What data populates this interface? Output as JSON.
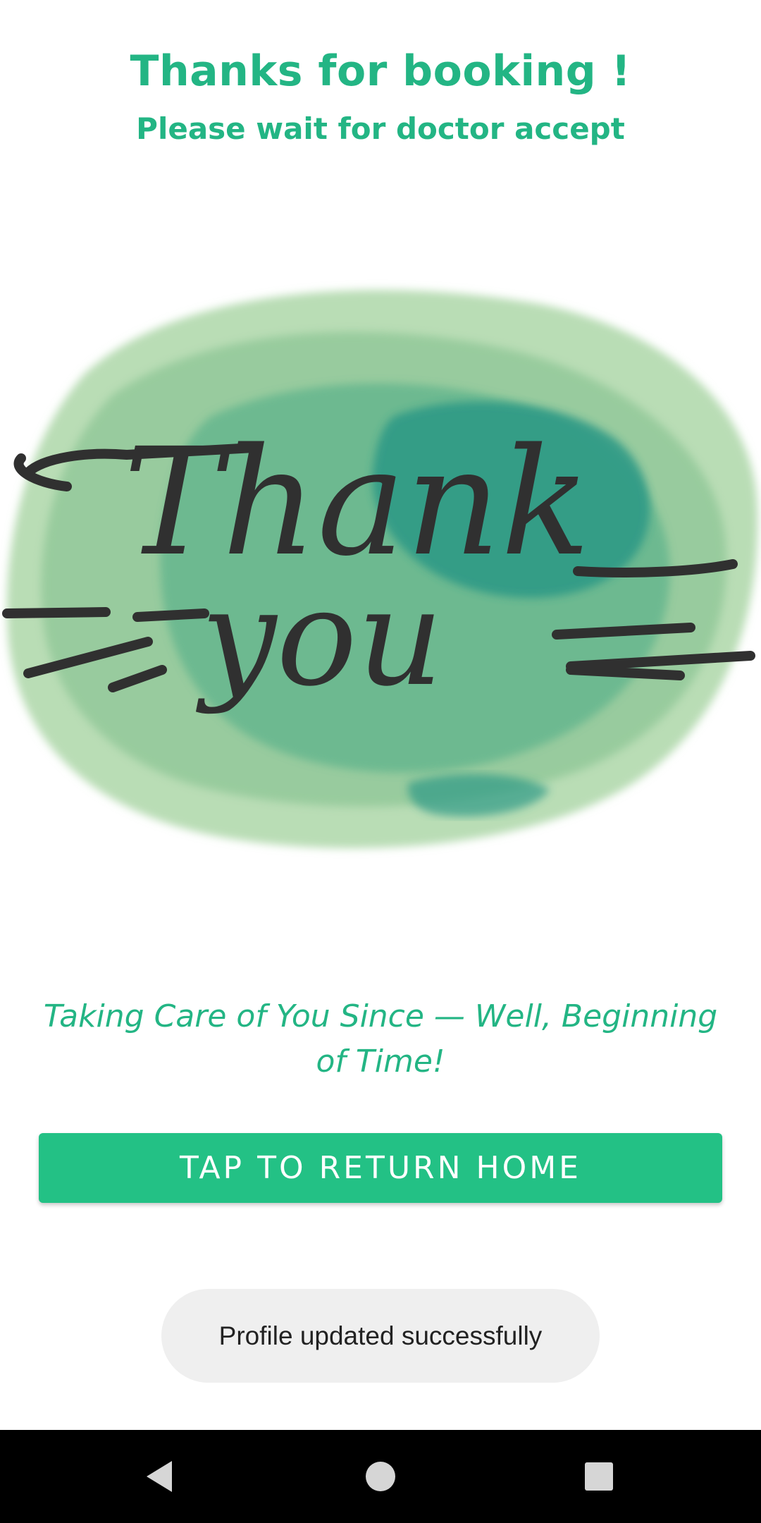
{
  "header": {
    "title": "Thanks for booking !",
    "subtitle": "Please wait for doctor accept"
  },
  "illustration": {
    "icon": "thank-you-watercolor-illustration",
    "text_line_1": "Thank",
    "text_line_2": "you",
    "colors": {
      "light_green": "#a9d3a4",
      "mid_green": "#6fbf8c",
      "teal": "#2f9a86",
      "ink": "#303030"
    }
  },
  "tagline": "Taking Care of You Since — Well, Beginning of Time!",
  "actions": {
    "home_button_label": "TAP TO RETURN HOME"
  },
  "toast": {
    "message": "Profile updated successfully"
  },
  "navbar": {
    "back_icon": "back-triangle-icon",
    "home_icon": "home-circle-icon",
    "recents_icon": "recents-square-icon"
  },
  "theme": {
    "accent": "#23b584",
    "button": "#23c185",
    "toast_bg": "#efefef",
    "navbar_bg": "#000000"
  }
}
